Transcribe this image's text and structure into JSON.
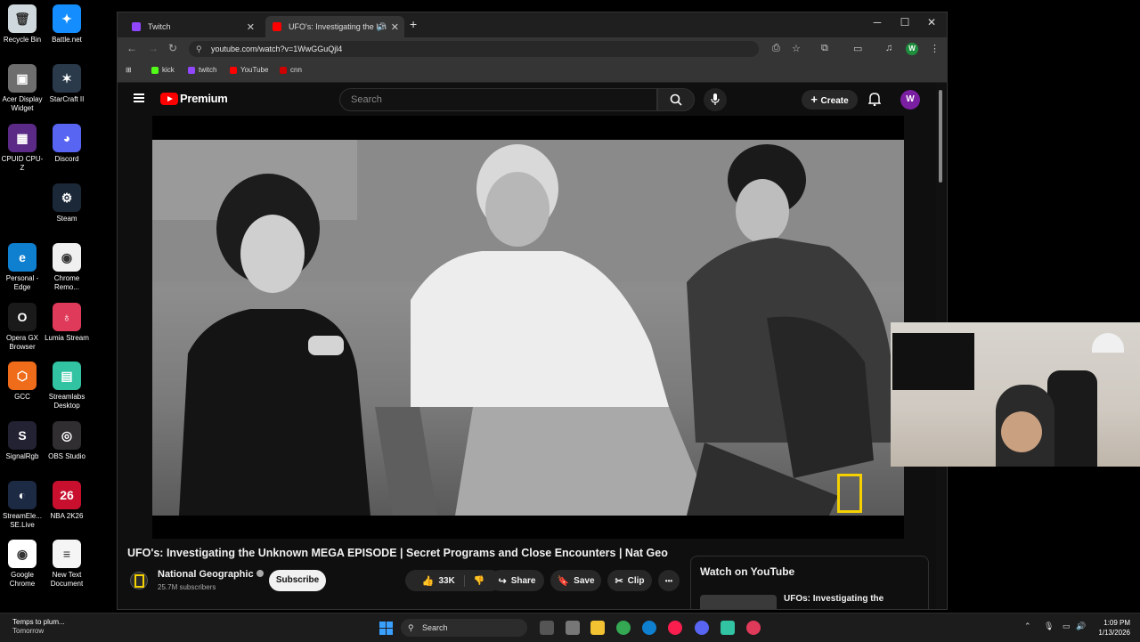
{
  "desktop": {
    "icons": [
      {
        "label": "Recycle Bin",
        "color": "#cfd8dc",
        "glyph": "🗑"
      },
      {
        "label": "Battle.net",
        "color": "#148eff",
        "glyph": "✦"
      },
      {
        "label": "Acer Display Widget",
        "color": "#6e6e6e",
        "glyph": "▣"
      },
      {
        "label": "StarCraft II",
        "color": "#2b3a4a",
        "glyph": "✶"
      },
      {
        "label": "CPUID CPU-Z",
        "color": "#5b2a86",
        "glyph": "▦"
      },
      {
        "label": "Discord",
        "color": "#5865f2",
        "glyph": "◕"
      },
      {
        "label": "Steam",
        "color": "#1b2838",
        "glyph": "⚙"
      },
      {
        "label": "Personal - Edge",
        "color": "#0f7fd0",
        "glyph": "e"
      },
      {
        "label": "Chrome Remo...",
        "color": "#f0f0f0",
        "glyph": "◉"
      },
      {
        "label": "Opera GX Browser",
        "color": "#1a1a1a",
        "glyph": "O"
      },
      {
        "label": "Lumia Stream",
        "color": "#e03a5a",
        "glyph": "♁"
      },
      {
        "label": "GCC",
        "color": "#ef6c1a",
        "glyph": "⬡"
      },
      {
        "label": "Streamlabs Desktop",
        "color": "#31c3a2",
        "glyph": "▤"
      },
      {
        "label": "SignalRgb",
        "color": "#222233",
        "glyph": "S"
      },
      {
        "label": "OBS Studio",
        "color": "#302e31",
        "glyph": "◎"
      },
      {
        "label": "StreamEle... SE.Live",
        "color": "#1d2a44",
        "glyph": "◐"
      },
      {
        "label": "NBA 2K26",
        "color": "#c8102e",
        "glyph": "26"
      },
      {
        "label": "Google Chrome",
        "color": "#ffffff",
        "glyph": "◉"
      },
      {
        "label": "New Text Document",
        "color": "#f5f5f5",
        "glyph": "≡"
      }
    ]
  },
  "browser": {
    "tabs": [
      {
        "label": "Twitch",
        "fav_color": "#9146ff",
        "active": false
      },
      {
        "label": "UFO's: Investigating the Un",
        "fav_color": "#ff0000",
        "active": true
      }
    ],
    "new_tab": "+",
    "url": "youtube.com/watch?v=1WwGGuQjl4",
    "bookmarks": [
      {
        "label": "kick",
        "color": "#53fc18"
      },
      {
        "label": "twitch",
        "color": "#9146ff"
      },
      {
        "label": "YouTube",
        "color": "#ff0000"
      },
      {
        "label": "cnn",
        "color": "#cc0000"
      }
    ],
    "profile_initial": "W"
  },
  "youtube": {
    "logo_text": "Premium",
    "search_placeholder": "Search",
    "create_label": "Create",
    "avatar_initial": "W",
    "video_title": "UFO's: Investigating the Unknown MEGA EPISODE | Secret Programs and Close Encounters | Nat Geo",
    "channel_name": "National Geographic",
    "subscribers": "25.7M subscribers",
    "subscribe_label": "Subscribe",
    "likes": "33K",
    "share_label": "Share",
    "save_label": "Save",
    "clip_label": "Clip",
    "more_label": "•••",
    "watch_panel_title": "Watch on YouTube",
    "watch_item_title": "UFOs: Investigating the"
  },
  "taskbar": {
    "weather_title": "Temps to plum...",
    "weather_sub": "Tomorrow",
    "search_label": "Search",
    "time": "1:09 PM",
    "date": "1/13/2026"
  }
}
